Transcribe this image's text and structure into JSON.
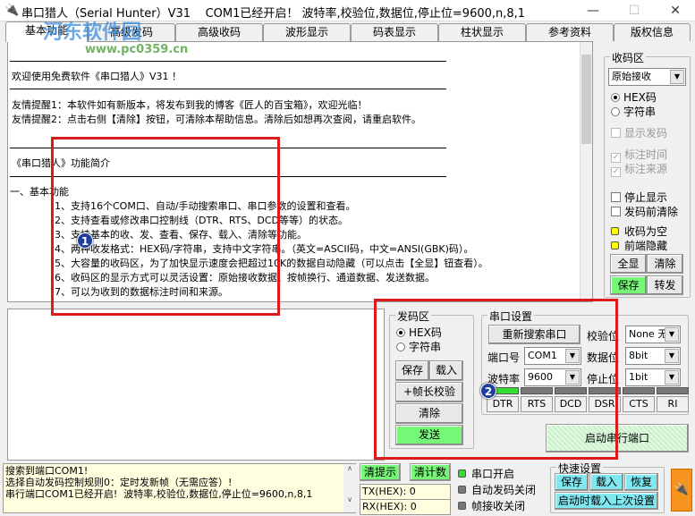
{
  "window": {
    "title": "串口猎人（Serial Hunter）V31    COM1已经开启！ 波特率,校验位,数据位,停止位=9600,n,8,1",
    "minimize": "—",
    "maximize": "☐",
    "close": "✕"
  },
  "watermark": {
    "name": "河东软件园",
    "url": "www.pc0359.cn"
  },
  "tabs": [
    "基本功能",
    "高级发码",
    "高级收码",
    "波形显示",
    "码表显示",
    "柱状显示",
    "参考资料",
    "版权信息"
  ],
  "help_text": {
    "welcome": "欢迎使用免费软件《串口猎人》V31 ！",
    "tip1": "友情提醒1：本软件如有新版本，将发布到我的博客《匠人的百宝箱》，欢迎光临！",
    "tip2": "友情提醒2：点击右侧【清除】按钮，可清除本帮助信息。清除后如想再次查阅，请重启软件。",
    "intro": "《串口猎人》功能简介",
    "section1": "一、基本功能",
    "items": [
      "1、支持16个COM口、自动/手动搜索串口、串口参数的设置和查看。",
      "2、支持查看或修改串口控制线（DTR、RTS、DCD等等）的状态。",
      "3、支持基本的收、发、查看、保存、载入、清除等功能。",
      "4、两种收发格式：HEX码/字符串，支持中文字符串。（英文=ASCII码，中文=ANSI(GBK)码）。",
      "5、大容量的收码区，为了加快显示速度会把超过10K的数据自动隐藏（可以点击【全显】钮查看）。",
      "6、收码区的显示方式可以灵活设置：原始接收数据、按帧换行、通道数据、发送数据。",
      "7、可以为收到的数据标注时间和来源。"
    ]
  },
  "receive": {
    "legend": "收码区",
    "mode": "原始接收",
    "hex": "HEX码",
    "string": "字符串",
    "show_send": "显示发码",
    "mark_time": "标注时间",
    "mark_source": "标注来源",
    "stop_display": "停止显示",
    "clear_before_send": "发码前清除",
    "empty": "收码为空",
    "front_hidden": "前端隐藏",
    "show_all": "全显",
    "clear": "清除",
    "save": "保存",
    "forward": "转发"
  },
  "send": {
    "legend": "发码区",
    "hex": "HEX码",
    "string": "字符串",
    "save": "保存",
    "load": "载入",
    "frame_check": "+帧长校验",
    "clear": "清除",
    "send": "发送"
  },
  "serial": {
    "legend": "串口设置",
    "rescan": "重新搜索串口",
    "parity_label": "校验位",
    "parity": "None 无",
    "port_label": "端口号",
    "port": "COM1",
    "databits_label": "数据位",
    "databits": "8bit",
    "baud_label": "波特率",
    "baud": "9600",
    "stopbits_label": "停止位",
    "stopbits": "1bit",
    "signals": [
      "DTR",
      "RTS",
      "DCD",
      "DSR",
      "CTS",
      "RI"
    ],
    "start": "启动串行端口"
  },
  "badges": [
    "1",
    "2"
  ],
  "status": {
    "log": "搜索到端口COM1!\n选择自动发码控制规则0：定时发新帧（无需应答）!\n串行端口COM1已经开启!  波特率,校验位,数据位,停止位=9600,n,8,1",
    "clear_tips": "清提示",
    "clear_count": "清计数",
    "tx": "TX(HEX): 0",
    "rx": "RX(HEX): 0",
    "port_open": "串口开启",
    "auto_send_off": "自动发码关闭",
    "frame_recv_off": "帧接收关闭"
  },
  "quick": {
    "legend": "快速设置",
    "save": "保存",
    "load": "载入",
    "restore": "恢复",
    "load_last": "启动时载入上次设置"
  },
  "colors": {
    "accent_green": "#77f777",
    "cyan": "#7fe8f0",
    "highlight_red": "#d91b1b",
    "orange": "#f7941d"
  }
}
